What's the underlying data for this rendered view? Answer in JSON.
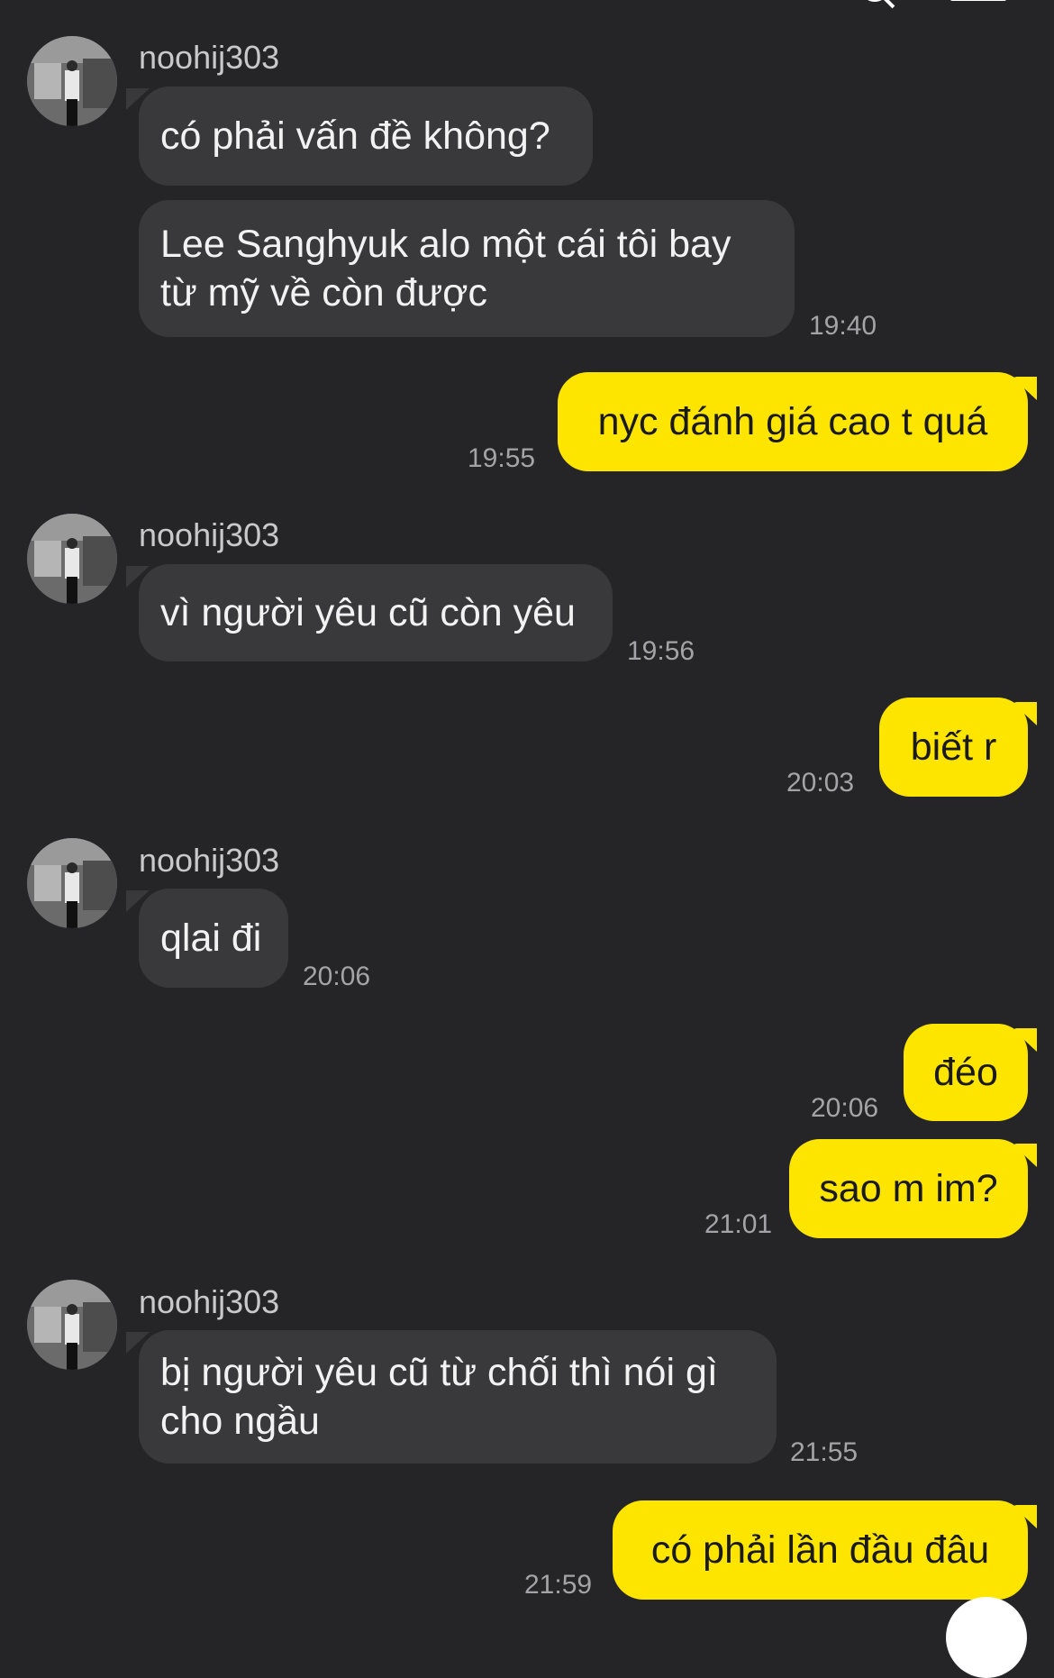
{
  "contact": {
    "name": "noohij303"
  },
  "messages": [
    {
      "id": 1,
      "from": "them",
      "text": "có phải vấn đề không?"
    },
    {
      "id": 2,
      "from": "them",
      "text": "Lee Sanghyuk alo một cái tôi bay từ mỹ về còn được",
      "time": "19:40"
    },
    {
      "id": 3,
      "from": "me",
      "text": "nyc đánh giá cao t quá",
      "time": "19:55"
    },
    {
      "id": 4,
      "from": "them",
      "text": "vì người yêu cũ còn yêu",
      "time": "19:56"
    },
    {
      "id": 5,
      "from": "me",
      "text": "biết r",
      "time": "20:03"
    },
    {
      "id": 6,
      "from": "them",
      "text": "qlai đi",
      "time": "20:06"
    },
    {
      "id": 7,
      "from": "me",
      "text": "đéo",
      "time": "20:06"
    },
    {
      "id": 8,
      "from": "me",
      "text": "sao m im?",
      "time": "21:01"
    },
    {
      "id": 9,
      "from": "them",
      "text": "bị người yêu cũ từ chối thì nói gì cho ngầu",
      "time": "21:55"
    },
    {
      "id": 10,
      "from": "me",
      "text": "có phải lần đầu đâu",
      "time": "21:59"
    }
  ],
  "colors": {
    "background": "#252528",
    "incoming_bubble": "#39393c",
    "outgoing_bubble": "#fee500",
    "timestamp": "#a4a4a8"
  },
  "icons": [
    "search-icon",
    "menu-icon",
    "avatar"
  ]
}
